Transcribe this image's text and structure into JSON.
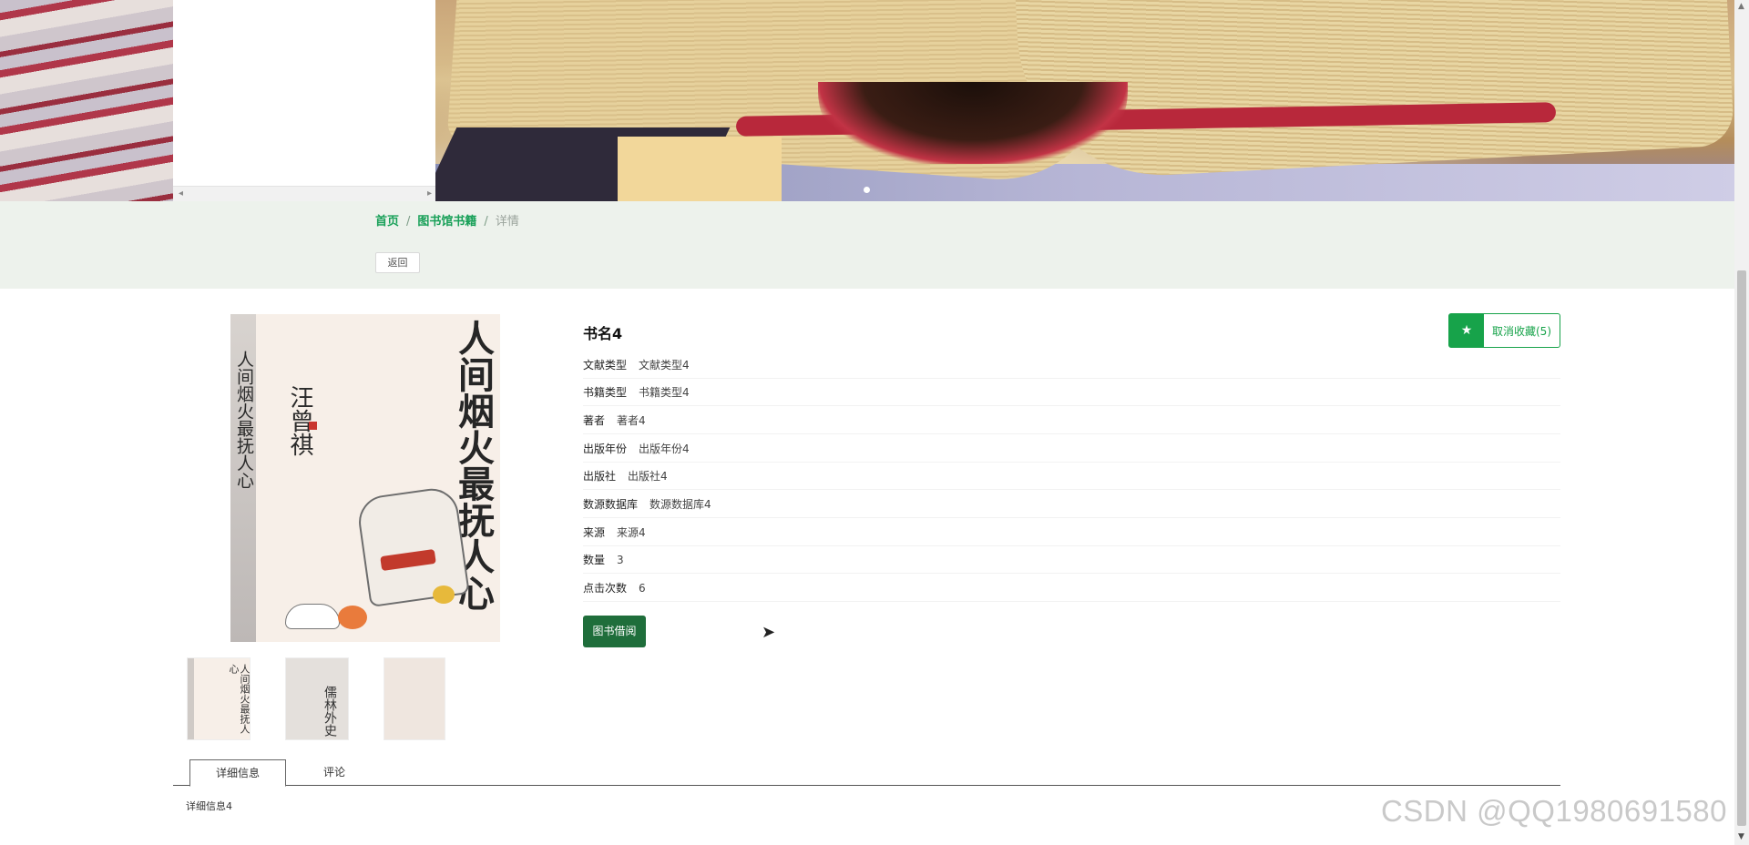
{
  "breadcrumb": {
    "home": "首页",
    "library": "图书馆书籍",
    "current": "详情",
    "sep": "/"
  },
  "back_label": "返回",
  "book": {
    "title": "书名4",
    "favorite_label": "取消收藏(5)",
    "fields": [
      {
        "label": "文献类型",
        "value": "文献类型4"
      },
      {
        "label": "书籍类型",
        "value": "书籍类型4"
      },
      {
        "label": "著者",
        "value": "著者4"
      },
      {
        "label": "出版年份",
        "value": "出版年份4"
      },
      {
        "label": "出版社",
        "value": "出版社4"
      },
      {
        "label": "数源数据库",
        "value": "数源数据库4"
      },
      {
        "label": "来源",
        "value": "来源4"
      },
      {
        "label": "数量",
        "value": "3"
      },
      {
        "label": "点击次数",
        "value": "6"
      }
    ],
    "borrow_label": "图书借阅"
  },
  "cover": {
    "title": "人间烟火最抚人心",
    "author": "汪曾祺"
  },
  "thumbnails": [
    {
      "text": "人间烟火最抚人心"
    },
    {
      "text": "儒林外史"
    },
    {
      "text": ""
    }
  ],
  "tabs": [
    {
      "label": "详细信息",
      "active": true
    },
    {
      "label": "评论",
      "active": false
    }
  ],
  "detail_text": "详细信息4",
  "watermark": "CSDN @QQ1980691580",
  "icons": {
    "favorite": "star-icon",
    "carousel_prev": "chevron-left-icon",
    "carousel_next": "chevron-right-icon"
  },
  "colors": {
    "accent": "#17a34a",
    "borrow": "#1f6e3b",
    "crumb_band": "#edf2ec"
  }
}
